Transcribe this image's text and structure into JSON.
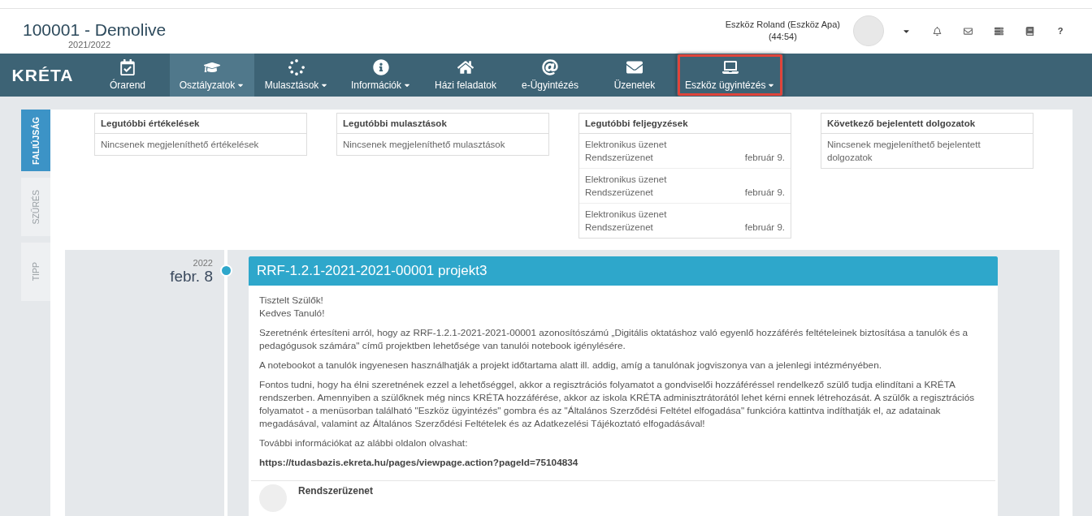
{
  "header": {
    "title": "100001 - Demolive",
    "school_year": "2021/2022",
    "user": "Eszköz Roland (Eszköz Apa)",
    "session_timer": "(44:54)",
    "help": "?"
  },
  "nav": {
    "logo": "KRÉTA",
    "items": [
      {
        "label": "Órarend",
        "dropdown": false,
        "selected": false,
        "highlighted": false
      },
      {
        "label": "Osztályzatok",
        "dropdown": true,
        "selected": true,
        "highlighted": false
      },
      {
        "label": "Mulasztások",
        "dropdown": true,
        "selected": false,
        "highlighted": false
      },
      {
        "label": "Információk",
        "dropdown": true,
        "selected": false,
        "highlighted": false
      },
      {
        "label": "Házi feladatok",
        "dropdown": false,
        "selected": false,
        "highlighted": false
      },
      {
        "label": "e-Ügyintézés",
        "dropdown": false,
        "selected": false,
        "highlighted": false
      },
      {
        "label": "Üzenetek",
        "dropdown": false,
        "selected": false,
        "highlighted": false
      },
      {
        "label": "Eszköz ügyintézés",
        "dropdown": true,
        "selected": false,
        "highlighted": true
      }
    ]
  },
  "side_tabs": [
    {
      "label": "FALIÚJSÁG",
      "selected": true
    },
    {
      "label": "SZŰRÉS",
      "selected": false
    },
    {
      "label": "TIPP",
      "selected": false
    }
  ],
  "widgets": [
    {
      "title": "Legutóbbi értékelések",
      "rows": [
        {
          "kind": "empty",
          "text": "Nincsenek megjeleníthető értékelések"
        }
      ]
    },
    {
      "title": "Legutóbbi mulasztások",
      "rows": [
        {
          "kind": "empty",
          "text": "Nincsenek megjeleníthető mulasztások"
        }
      ]
    },
    {
      "title": "Legutóbbi feljegyzések",
      "rows": [
        {
          "kind": "note",
          "title": "Elektronikus üzenet",
          "subtitle": "Rendszerüzenet",
          "date": "február 9."
        },
        {
          "kind": "note",
          "title": "Elektronikus üzenet",
          "subtitle": "Rendszerüzenet",
          "date": "február 9."
        },
        {
          "kind": "note",
          "title": "Elektronikus üzenet",
          "subtitle": "Rendszerüzenet",
          "date": "február 9."
        }
      ]
    },
    {
      "title": "Következő bejelentett dolgozatok",
      "rows": [
        {
          "kind": "empty",
          "text": "Nincsenek megjeleníthető bejelentett dolgozatok"
        }
      ]
    }
  ],
  "timeline": [
    {
      "year": "2022",
      "date": "febr. 8",
      "title": "RRF-1.2.1-2021-2021-00001 projekt3",
      "greetings": [
        "Tisztelt Szülők!",
        "Kedves Tanuló!"
      ],
      "paragraphs": [
        "Szeretnénk értesíteni arról, hogy az RRF-1.2.1-2021-2021-00001 azonosítószámú „Digitális oktatáshoz való egyenlő hozzáférés feltételeinek biztosítása a tanulók és a pedagógusok számára\" című projektben lehetősége van tanulói notebook igénylésére.",
        "A notebookot a tanulók ingyenesen használhatják a projekt időtartama alatt ill. addig, amíg a tanulónak jogviszonya van a jelenlegi intézményében.",
        "Fontos tudni, hogy ha élni szeretnének ezzel a lehetőséggel, akkor a regisztrációs folyamatot a gondviselői hozzáféréssel rendelkező szülő tudja elindítani a KRÉTA rendszerben. Amennyiben a szülőknek még nincs KRÉTA hozzáférése, akkor az iskola KRÉTA adminisztrátorától lehet kérni ennek létrehozását. A szülők a regisztrációs folyamatot - a menüsorban található \"Eszköz ügyintézés\" gombra és az \"Általános Szerződési Feltétel elfogadása\" funkcióra kattintva indíthatják el, az adatainak megadásával, valamint az Általános Szerződési Feltételek és az Adatkezelési Tájékoztató elfogadásával!",
        "További információkat az alábbi oldalon olvashat:"
      ],
      "link": "https://tudasbazis.ekreta.hu/pages/viewpage.action?pageId=75104834",
      "author": "Rendszerüzenet"
    }
  ]
}
